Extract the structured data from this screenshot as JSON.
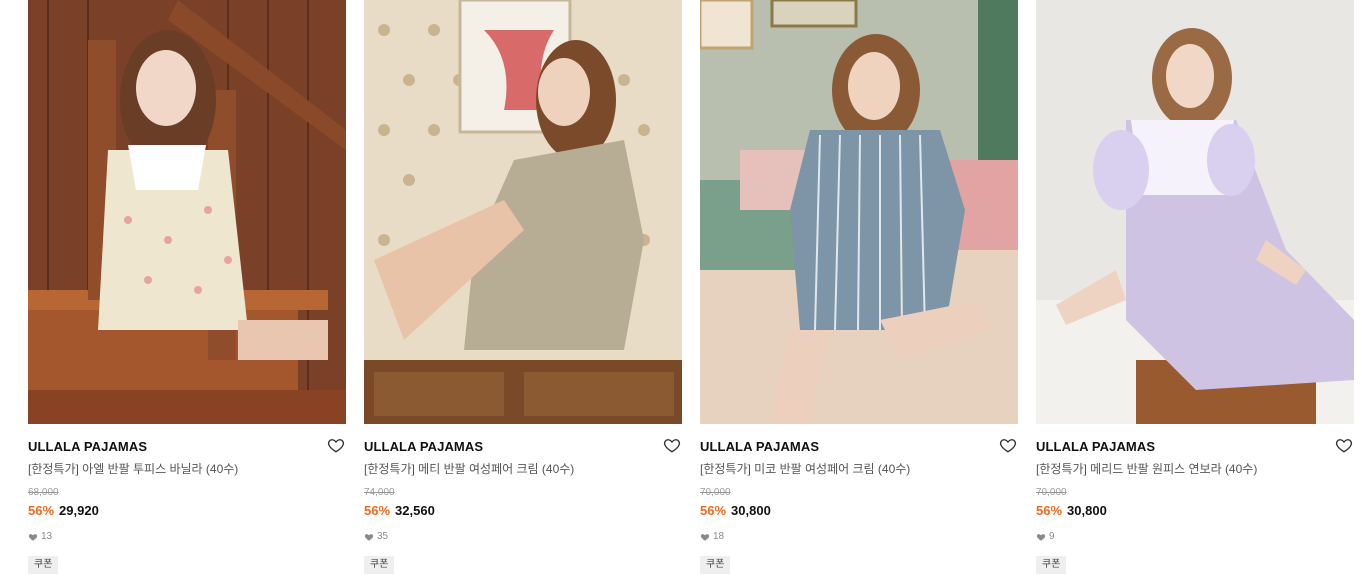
{
  "products": [
    {
      "brand": "ULLALA PAJAMAS",
      "name": "[한정특가] 아엘 반팔 투피스 바닐라 (40수)",
      "original_price": "68,000",
      "discount": "56%",
      "sale_price": "29,920",
      "likes": "13",
      "badge": "쿠폰",
      "image": "model-floral-pajama-staircase"
    },
    {
      "brand": "ULLALA PAJAMAS",
      "name": "[한정특가] 메티 반팔 여성페어 크림 (40수)",
      "original_price": "74,000",
      "discount": "56%",
      "sale_price": "32,560",
      "likes": "35",
      "badge": "쿠폰",
      "image": "model-sitting-on-dresser"
    },
    {
      "brand": "ULLALA PAJAMAS",
      "name": "[한정특가] 미코 반팔 여성페어 크림 (40수)",
      "original_price": "70,000",
      "discount": "56%",
      "sale_price": "30,800",
      "likes": "18",
      "badge": "쿠폰",
      "image": "model-striped-pajama-bed"
    },
    {
      "brand": "ULLALA PAJAMAS",
      "name": "[한정특가] 메리드 반팔 원피스 연보라 (40수)",
      "original_price": "70,000",
      "discount": "56%",
      "sale_price": "30,800",
      "likes": "9",
      "badge": "쿠폰",
      "image": "model-lavender-nightdress"
    }
  ],
  "colors": {
    "discount": "#ef6a1f",
    "price": "#111111",
    "original_price": "#9a9a9a",
    "badge_bg": "#efefef"
  },
  "icons": {
    "wishlist": "heart-outline-icon",
    "likes": "heart-filled-icon"
  }
}
